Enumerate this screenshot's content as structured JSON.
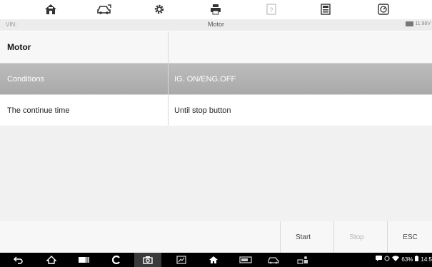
{
  "toolbar": {
    "buttons": [
      {
        "icon": "home-icon"
      },
      {
        "icon": "vehicle-swap-icon"
      },
      {
        "icon": "gear-icon"
      },
      {
        "icon": "printer-icon"
      },
      {
        "icon": "help-icon"
      },
      {
        "icon": "save-icon"
      },
      {
        "icon": "data-logging-icon"
      }
    ]
  },
  "status": {
    "vin_label": "VIN:",
    "title": "Motor",
    "voltage": "11.98V"
  },
  "table": {
    "header": {
      "name": "Motor",
      "value": ""
    },
    "rows": [
      {
        "name": "Conditions",
        "value": "IG. ON/ENG.OFF"
      },
      {
        "name": "The continue time",
        "value": "Until stop button"
      }
    ]
  },
  "actions": {
    "start": "Start",
    "stop": "Stop",
    "esc": "ESC"
  },
  "system": {
    "battery": "63%",
    "time": "14:5"
  },
  "colors": {
    "selected_row": "#b0b0b0",
    "navbar": "#000000",
    "disabled_text": "#b5b5b5"
  }
}
